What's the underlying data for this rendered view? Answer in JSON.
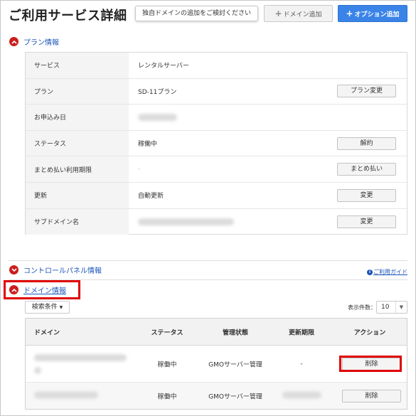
{
  "page": {
    "title": "ご利用サービス詳細",
    "tooltip": "独自ドメインの追加をご検討ください",
    "domain_add_label": "ドメイン追加",
    "option_add_label": "オプション追加"
  },
  "plan_section": {
    "label": "プラン情報",
    "rows": [
      {
        "key": "サービス",
        "value": "レンタルサーバー",
        "button": ""
      },
      {
        "key": "プラン",
        "value": "SD-11プラン",
        "button": "プラン変更"
      },
      {
        "key": "お申込み日",
        "value": "",
        "button": ""
      },
      {
        "key": "ステータス",
        "value": "稼働中",
        "button": "解約"
      },
      {
        "key": "まとめ払い利用期限",
        "value": "-",
        "button": "まとめ払い"
      },
      {
        "key": "更新",
        "value": "自動更新",
        "button": "変更"
      },
      {
        "key": "サブドメイン名",
        "value": "",
        "button": "変更"
      }
    ]
  },
  "control_panel_section": {
    "label": "コントロールパネル情報",
    "help_link": "ご利用ガイド"
  },
  "domain_section": {
    "label": "ドメイン情報",
    "filter_label": "検索条件",
    "count_label": "表示件数：",
    "count_value": "10",
    "columns": [
      "ドメイン",
      "ステータス",
      "管理状態",
      "更新期限",
      "アクション"
    ],
    "rows": [
      {
        "status": "稼働中",
        "management": "GMOサーバー管理",
        "expiry": "-",
        "action": "削除"
      },
      {
        "status": "稼働中",
        "management": "GMOサーバー管理",
        "expiry": "",
        "action": "削除"
      }
    ]
  },
  "colors": {
    "accent_blue": "#3a84e8",
    "link_blue": "#1a53b8",
    "toggle_red": "#cc1d1d",
    "highlight_red": "#e00000"
  },
  "icons": [
    "plus-icon",
    "chevron-up-icon",
    "info-icon",
    "caret-down-icon"
  ]
}
